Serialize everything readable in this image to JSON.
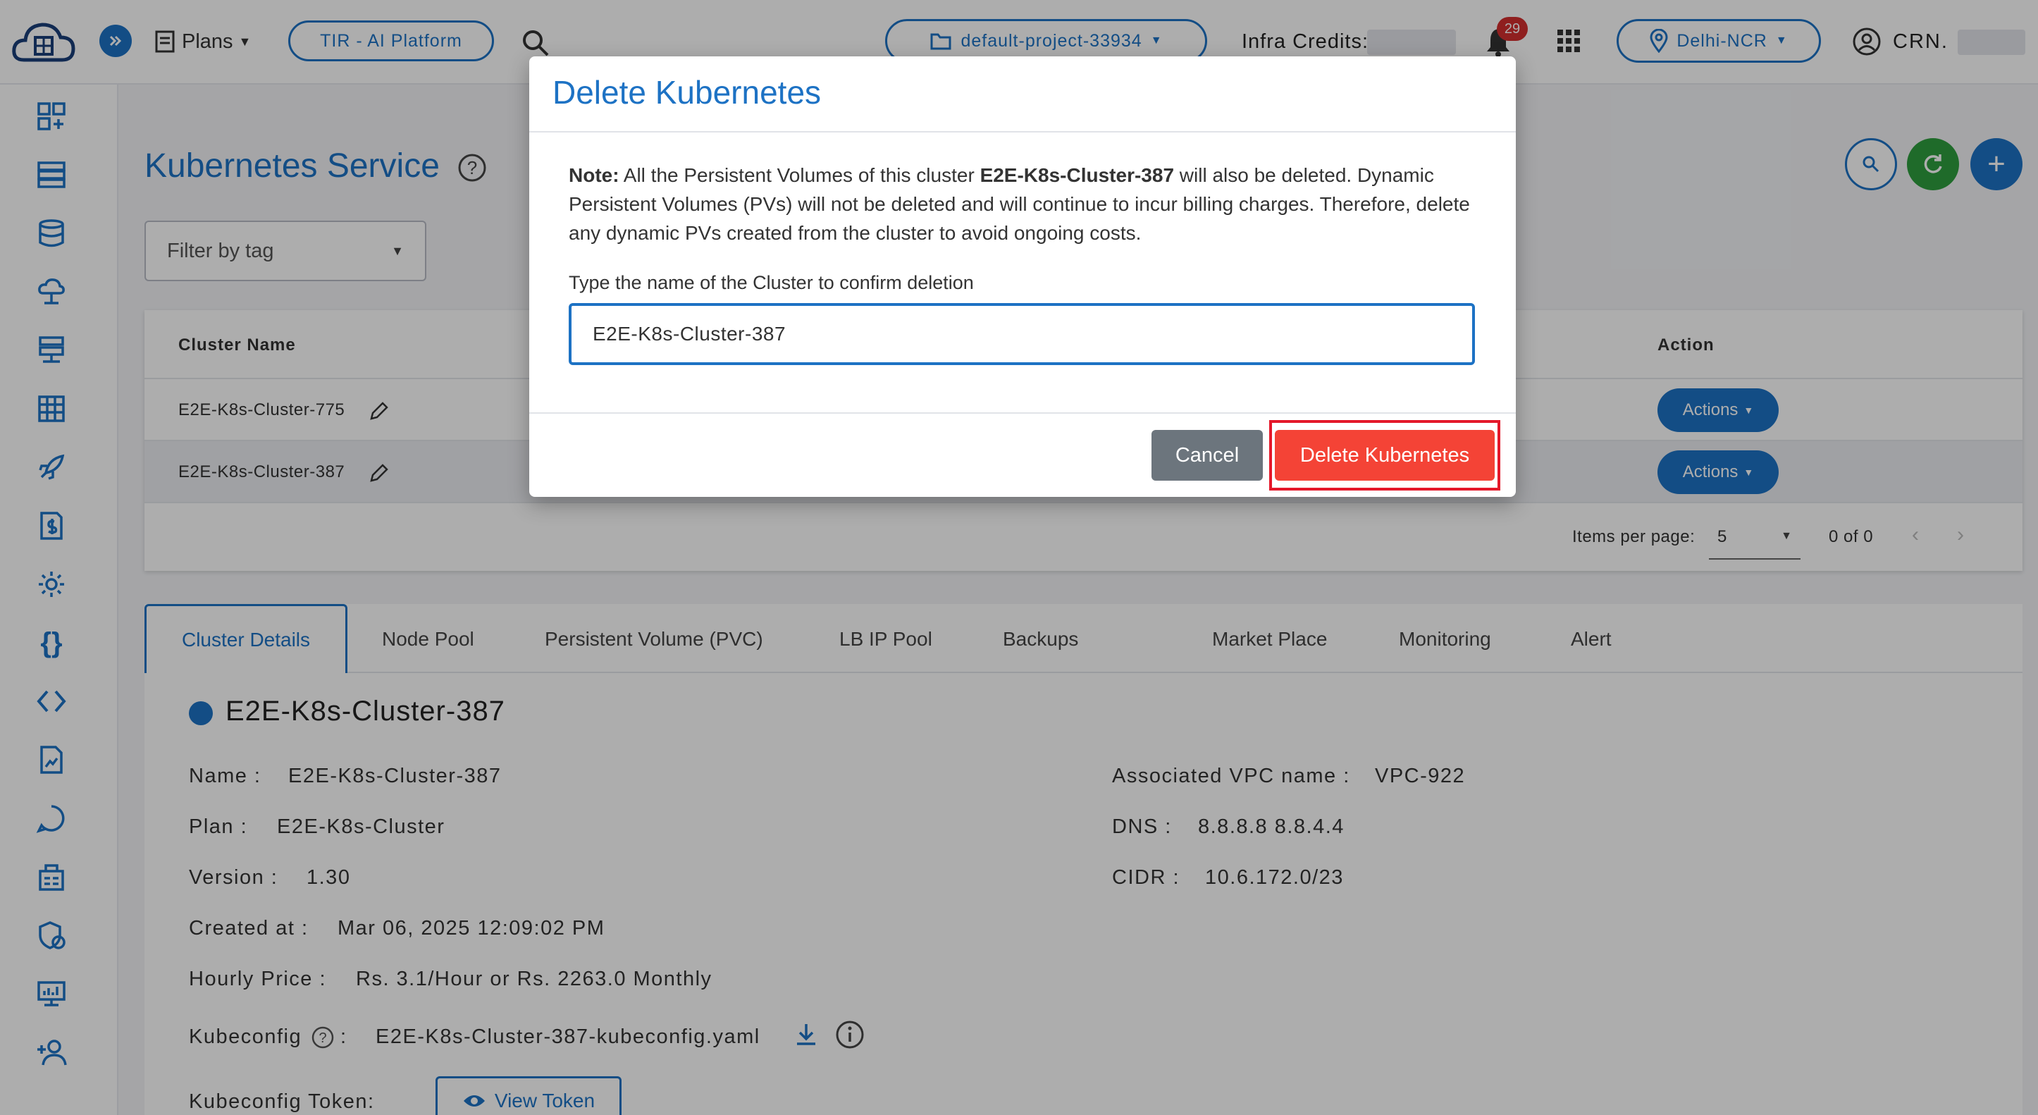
{
  "header": {
    "plans_label": "Plans",
    "platform_label": "TIR - AI Platform",
    "project_label": "default-project-33934",
    "infra_credits_label": "Infra Credits:",
    "notification_count": "29",
    "region_label": "Delhi-NCR",
    "account_label": "CRN."
  },
  "page": {
    "title": "Kubernetes Service",
    "filter_placeholder": "Filter by tag"
  },
  "table": {
    "columns": {
      "cluster_name": "Cluster Name",
      "action": "Action"
    },
    "rows": [
      {
        "name": "E2E-K8s-Cluster-775",
        "action": "Actions"
      },
      {
        "name": "E2E-K8s-Cluster-387",
        "action": "Actions"
      }
    ],
    "pagination": {
      "items_per_page_label": "Items per page:",
      "per_page": "5",
      "range": "0 of 0"
    }
  },
  "tabs": [
    "Cluster Details",
    "Node Pool",
    "Persistent Volume (PVC)",
    "LB IP Pool",
    "Backups",
    "Market Place",
    "Monitoring",
    "Alert"
  ],
  "details": {
    "cluster_title": "E2E-K8s-Cluster-387",
    "name_label": "Name :",
    "name_value": "E2E-K8s-Cluster-387",
    "plan_label": "Plan :",
    "plan_value": "E2E-K8s-Cluster",
    "version_label": "Version :",
    "version_value": "1.30",
    "created_label": "Created at :",
    "created_value": "Mar 06, 2025 12:09:02 PM",
    "price_label": "Hourly Price :",
    "price_value": "Rs. 3.1/Hour or Rs. 2263.0 Monthly",
    "kubeconfig_label": "Kubeconfig",
    "kubeconfig_colon": ":",
    "kubeconfig_value": "E2E-K8s-Cluster-387-kubeconfig.yaml",
    "token_label": "Kubeconfig Token:",
    "token_button": "View Token",
    "vpc_label": "Associated VPC name :",
    "vpc_value": "VPC-922",
    "dns_label": "DNS :",
    "dns_value": "8.8.8.8 8.8.4.4",
    "cidr_label": "CIDR :",
    "cidr_value": "10.6.172.0/23"
  },
  "modal": {
    "title": "Delete Kubernetes",
    "note_prefix": "Note:",
    "note_part1": " All the Persistent Volumes of this cluster ",
    "note_cluster": "E2E-K8s-Cluster-387",
    "note_part2": " will also be deleted. Dynamic Persistent Volumes (PVs) will not be deleted and will continue to incur billing charges. Therefore, delete any dynamic PVs created from the cluster to avoid ongoing costs.",
    "confirm_label": "Type the name of the Cluster to confirm deletion",
    "confirm_value": "E2E-K8s-Cluster-387",
    "cancel_label": "Cancel",
    "delete_label": "Delete Kubernetes"
  },
  "colors": {
    "primary": "#1d72c4",
    "danger": "#f44336",
    "success": "#2e9e3e",
    "cancel": "#6c757d"
  }
}
